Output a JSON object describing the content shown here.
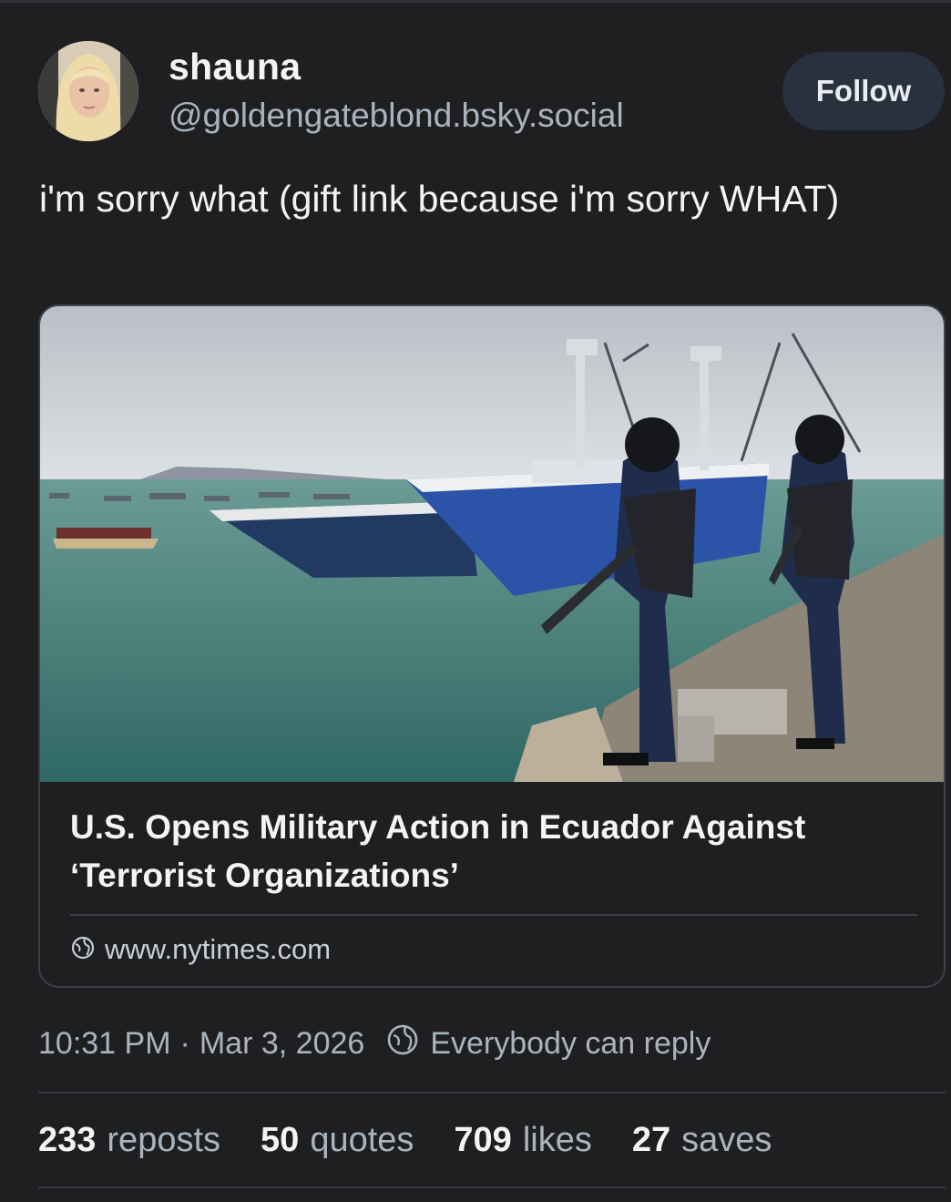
{
  "author": {
    "display_name": "shauna",
    "handle": "@goldengateblond.bsky.social",
    "follow_label": "Follow"
  },
  "post": {
    "text": "i'm sorry what (gift link because i'm sorry WHAT)"
  },
  "link_card": {
    "title": "U.S. Opens Military Action in Ecuador Against ‘Terrorist Organizations’",
    "domain": "www.nytimes.com",
    "domain_icon": "globe-icon"
  },
  "meta": {
    "time": "10:31 PM",
    "separator": "·",
    "date": "Mar 3, 2026",
    "reply_setting": "Everybody can reply",
    "reply_icon": "globe-icon"
  },
  "stats": [
    {
      "count": "233",
      "label": "reposts"
    },
    {
      "count": "50",
      "label": "quotes"
    },
    {
      "count": "709",
      "label": "likes"
    },
    {
      "count": "27",
      "label": "saves"
    }
  ],
  "colors": {
    "background": "#1f1f21",
    "follow_button": "#27323e",
    "muted_text": "#aab4bf",
    "border": "#3b4147"
  }
}
